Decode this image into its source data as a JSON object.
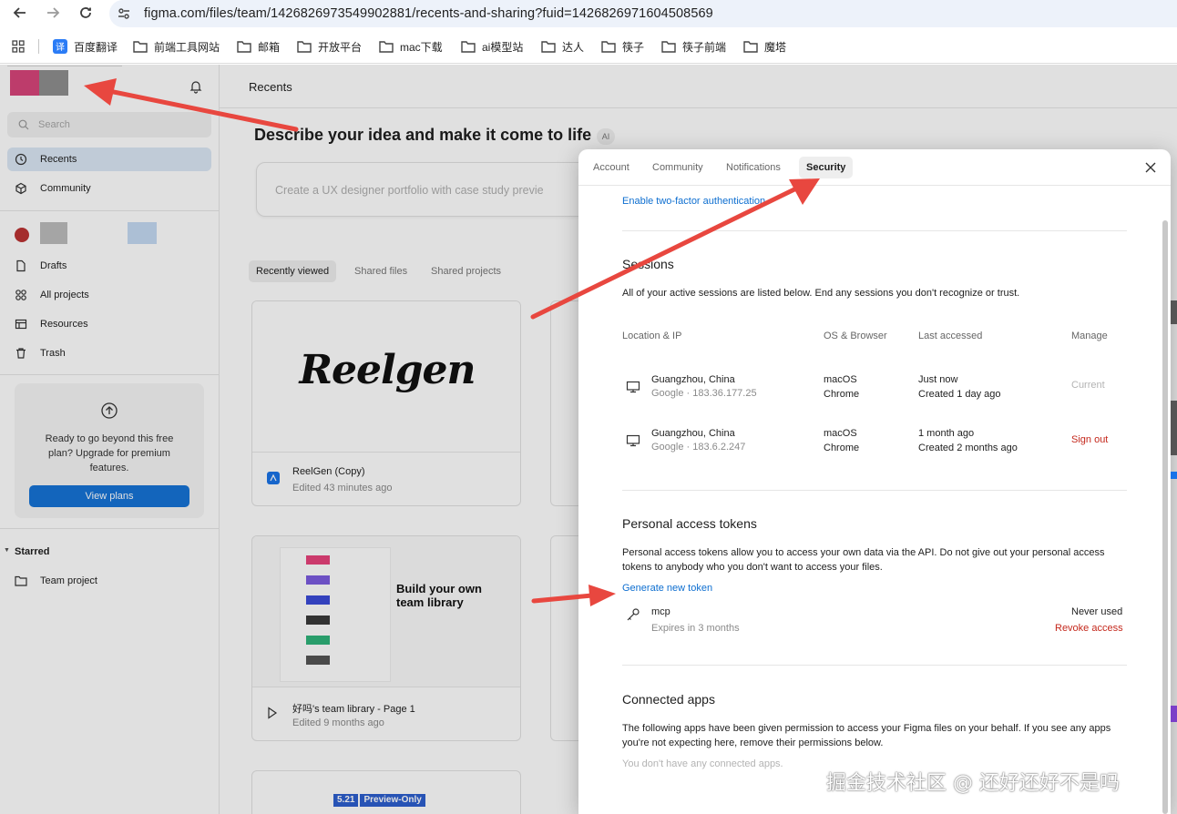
{
  "browser": {
    "url": "figma.com/files/team/1426826973549902881/recents-and-sharing?fuid=1426826971604508569",
    "bookmarks": [
      "百度翻译",
      "前端工具网站",
      "邮箱",
      "开放平台",
      "mac下载",
      "ai模型站",
      "达人",
      "筷子",
      "筷子前端",
      "魔塔"
    ]
  },
  "sidebar": {
    "search_placeholder": "Search",
    "nav": [
      {
        "label": "Recents",
        "icon": "clock-icon",
        "active": true
      },
      {
        "label": "Community",
        "icon": "globe-icon",
        "active": false
      }
    ],
    "team_items": [
      {
        "label": "Drafts",
        "icon": "file-icon"
      },
      {
        "label": "All projects",
        "icon": "grid-icon"
      },
      {
        "label": "Resources",
        "icon": "book-icon"
      },
      {
        "label": "Trash",
        "icon": "trash-icon"
      }
    ],
    "upgrade_text": "Ready to go beyond this free plan? Upgrade for premium features.",
    "upgrade_button": "View plans",
    "starred_heading": "Starred",
    "starred_items": [
      {
        "label": "Team project",
        "icon": "folder-icon"
      }
    ]
  },
  "main": {
    "title": "Recents",
    "hero": "Describe your idea and make it come to life",
    "hero_badge": "AI",
    "prompt_placeholder": "Create a UX designer portfolio with case study previe",
    "filter_tabs": [
      {
        "label": "Recently viewed",
        "active": true
      },
      {
        "label": "Shared files",
        "active": false
      },
      {
        "label": "Shared projects",
        "active": false
      }
    ],
    "cards": [
      {
        "title": "ReelGen (Copy)",
        "meta": "Edited 43 minutes ago",
        "thumb_text": "Reelgen"
      },
      {
        "title": "好吗's team library - Page 1",
        "meta": "Edited 9 months ago",
        "thumb_text": "Build your own team library"
      }
    ],
    "preview_badge": [
      "5.21",
      "Preview-Only"
    ]
  },
  "modal": {
    "tabs": [
      {
        "label": "Account",
        "active": false
      },
      {
        "label": "Community",
        "active": false
      },
      {
        "label": "Notifications",
        "active": false
      },
      {
        "label": "Security",
        "active": true
      }
    ],
    "twofa_link": "Enable two-factor authentication",
    "sessions": {
      "heading": "Sessions",
      "description": "All of your active sessions are listed below. End any sessions you don't recognize or trust.",
      "columns": [
        "Location & IP",
        "OS & Browser",
        "Last accessed",
        "Manage"
      ],
      "rows": [
        {
          "location": "Guangzhou, China",
          "ip": "Google · 183.36.177.25",
          "os": "macOS",
          "browser": "Chrome",
          "last": "Just now",
          "created": "Created 1 day ago",
          "manage": "Current"
        },
        {
          "location": "Guangzhou, China",
          "ip": "Google · 183.6.2.247",
          "os": "macOS",
          "browser": "Chrome",
          "last": "1 month ago",
          "created": "Created 2 months ago",
          "manage": "Sign out"
        }
      ]
    },
    "tokens": {
      "heading": "Personal access tokens",
      "description": "Personal access tokens allow you to access your own data via the API. Do not give out your personal access tokens to anybody who you don't want to access your files.",
      "generate_link": "Generate new token",
      "items": [
        {
          "name": "mcp",
          "expires": "Expires in 3 months",
          "usage": "Never used",
          "action": "Revoke access"
        }
      ]
    },
    "apps": {
      "heading": "Connected apps",
      "description": "The following apps have been given permission to access your Figma files on your behalf. If you see any apps you're not expecting here, remove their permissions below.",
      "empty": "You don't have any connected apps."
    }
  },
  "watermark": "掘金技术社区 @ 还好还好不是吗",
  "colors": {
    "accent": "#0d6ed0",
    "danger": "#c4281c",
    "arrow": "#e8473f"
  }
}
